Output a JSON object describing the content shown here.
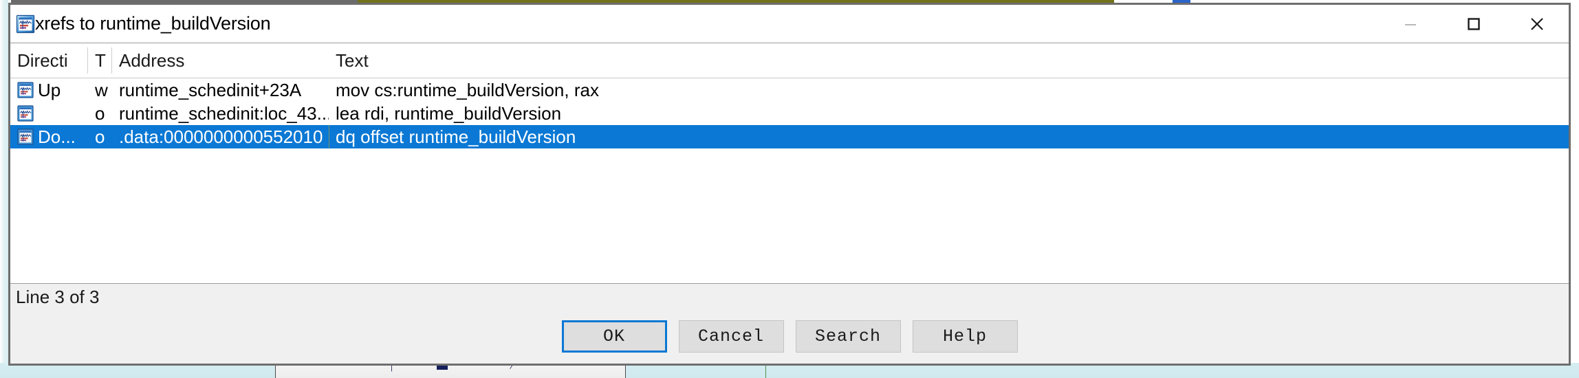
{
  "window": {
    "title": "xrefs to runtime_buildVersion",
    "icon": "ida-xref-icon",
    "controls": [
      {
        "name": "minimize-button",
        "glyph": "minimize",
        "label": "Minimize",
        "enabled": false
      },
      {
        "name": "maximize-button",
        "glyph": "maximize",
        "label": "Maximize",
        "enabled": true
      },
      {
        "name": "close-button",
        "glyph": "close",
        "label": "Close",
        "enabled": true
      }
    ]
  },
  "table": {
    "columns": [
      {
        "key": "direction",
        "label": "Directi"
      },
      {
        "key": "type",
        "label": "T"
      },
      {
        "key": "address",
        "label": "Address"
      },
      {
        "key": "text",
        "label": "Text"
      }
    ],
    "rows": [
      {
        "icon": "ida-xref-icon",
        "direction": "Up",
        "type": "w",
        "address": "runtime_schedinit+23A",
        "text": "mov     cs:runtime_buildVersion, rax",
        "selected": false
      },
      {
        "icon": "ida-xref-icon",
        "direction": "",
        "type": "o",
        "address": "runtime_schedinit:loc_43...",
        "text": "lea     rdi, runtime_buildVersion",
        "selected": false
      },
      {
        "icon": "ida-xref-icon",
        "direction": "Do...",
        "type": "o",
        "address": ".data:0000000000552010",
        "text": "dq offset runtime_buildVersion",
        "selected": true
      }
    ]
  },
  "status": {
    "line_info": "Line 3 of 3"
  },
  "buttons": [
    {
      "name": "ok-button",
      "label": "OK",
      "default": true
    },
    {
      "name": "cancel-button",
      "label": "Cancel",
      "default": false
    },
    {
      "name": "search-button",
      "label": "Search",
      "default": false
    },
    {
      "name": "help-button",
      "label": "Help",
      "default": false
    }
  ],
  "colors": {
    "selection_blue": "#0a78d4",
    "focus_border": "#0a78d4",
    "focus_dotted": "#f0a800",
    "window_border": "#6e6e6e",
    "statusbar_bg": "#f0f0f0",
    "button_face": "#dedede",
    "olive_bar": "#73721a",
    "desktop_tint": "#d8eef1"
  }
}
